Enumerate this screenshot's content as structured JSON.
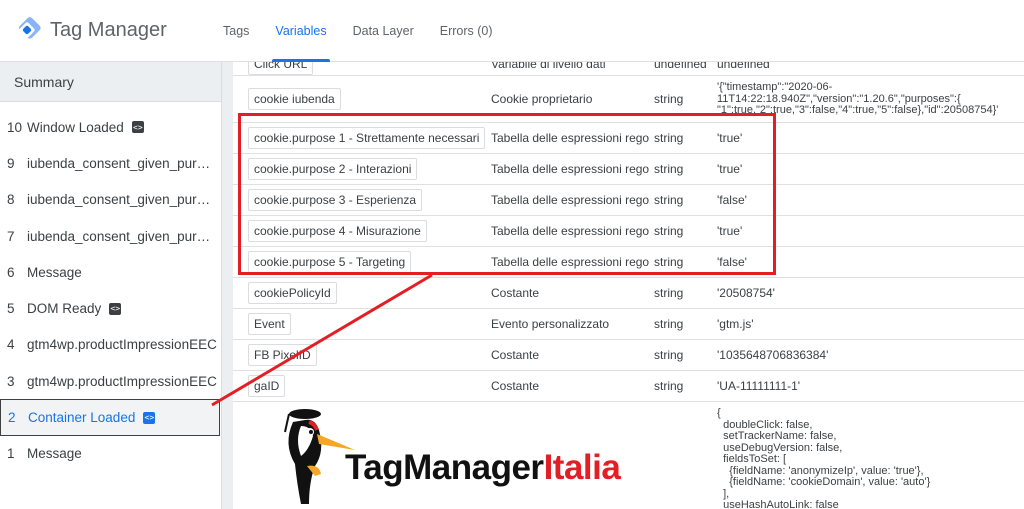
{
  "app": {
    "title": "Tag Manager"
  },
  "tabs": [
    {
      "label": "Tags",
      "active": false
    },
    {
      "label": "Variables",
      "active": true
    },
    {
      "label": "Data Layer",
      "active": false
    },
    {
      "label": "Errors (0)",
      "active": false
    }
  ],
  "sidebar": {
    "summary": "Summary",
    "events": [
      {
        "num": "10",
        "label": "Window Loaded",
        "code_icon": true
      },
      {
        "num": "9",
        "label": "iubenda_consent_given_purpose...",
        "code_icon": false
      },
      {
        "num": "8",
        "label": "iubenda_consent_given_purpose...",
        "code_icon": false
      },
      {
        "num": "7",
        "label": "iubenda_consent_given_purpose...",
        "code_icon": false
      },
      {
        "num": "6",
        "label": "Message",
        "code_icon": false
      },
      {
        "num": "5",
        "label": "DOM Ready",
        "code_icon": true
      },
      {
        "num": "4",
        "label": "gtm4wp.productImpressionEEC",
        "code_icon": false
      },
      {
        "num": "3",
        "label": "gtm4wp.productImpressionEEC",
        "code_icon": false
      },
      {
        "num": "2",
        "label": "Container Loaded",
        "code_icon": true,
        "selected": true
      },
      {
        "num": "1",
        "label": "Message",
        "code_icon": false
      }
    ]
  },
  "variables": [
    {
      "name": "Click URL",
      "type": "Variabile di livello dati",
      "dtype": "undefined",
      "value": "undefined"
    },
    {
      "name": "cookie iubenda",
      "type": "Cookie proprietario",
      "dtype": "string",
      "value": "'{\"timestamp\":\"2020-06-\n11T14:22:18.940Z\",\"version\":\"1.20.6\",\"purposes\":{\n\"1\":true,\"2\":true,\"3\":false,\"4\":true,\"5\":false},\"id\":20508754}'"
    },
    {
      "name": "cookie.purpose 1 - Strettamente necessari",
      "type": "Tabella delle espressioni regolari",
      "dtype": "string",
      "value": "'true'"
    },
    {
      "name": "cookie.purpose 2 - Interazioni",
      "type": "Tabella delle espressioni regolari",
      "dtype": "string",
      "value": "'true'"
    },
    {
      "name": "cookie.purpose 3 - Esperienza",
      "type": "Tabella delle espressioni regolari",
      "dtype": "string",
      "value": "'false'"
    },
    {
      "name": "cookie.purpose 4 - Misurazione",
      "type": "Tabella delle espressioni regolari",
      "dtype": "string",
      "value": "'true'"
    },
    {
      "name": "cookie.purpose 5 - Targeting",
      "type": "Tabella delle espressioni regolari",
      "dtype": "string",
      "value": "'false'"
    },
    {
      "name": "cookiePolicyId",
      "type": "Costante",
      "dtype": "string",
      "value": "'20508754'"
    },
    {
      "name": "Event",
      "type": "Evento personalizzato",
      "dtype": "string",
      "value": "'gtm.js'"
    },
    {
      "name": "FB PixelID",
      "type": "Costante",
      "dtype": "string",
      "value": "'1035648706836384'"
    },
    {
      "name": "gaID",
      "type": "Costante",
      "dtype": "string",
      "value": "'UA-11111111-1'"
    },
    {
      "name": "",
      "type": "",
      "dtype": "",
      "value": "{\n  doubleClick: false,\n  setTrackerName: false,\n  useDebugVersion: false,\n  fieldsToSet: [\n    {fieldName: 'anonymizeIp', value: 'true'},\n    {fieldName: 'cookieDomain', value: 'auto'}\n  ],\n  useHashAutoLink: false"
    }
  ],
  "brand": {
    "part1": "TagManager",
    "part2": "Italia"
  },
  "colors": {
    "accent": "#1a73e8",
    "highlight": "#e31e24"
  }
}
